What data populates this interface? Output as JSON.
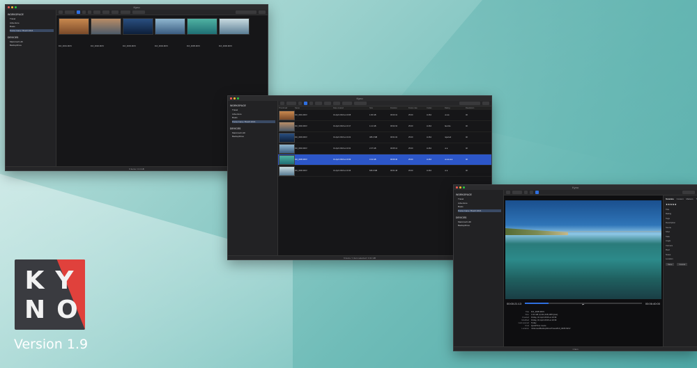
{
  "brand": {
    "logo_line1": "KY",
    "logo_line2": "NO",
    "version": "Version 1.9",
    "colors": {
      "logo_bg": "#3a3b40",
      "logo_accent": "#e0413c",
      "background": "#6fbcb8"
    }
  },
  "window_grid": {
    "title": "Kyno",
    "sidebar": {
      "section1": "WORKSPACE",
      "rows": [
        "Travel",
        "Adventure",
        "Boats",
        "Punta Cana / Brazil 2016"
      ],
      "section2": "DEVICES",
      "devices": [
        "Macintosh HD",
        "BackupDrive"
      ]
    },
    "thumbnails": [
      {
        "name": "DJI_0001.MOV",
        "colors": [
          "#7a4a2a",
          "#c8884e"
        ]
      },
      {
        "name": "DJI_0002.MOV",
        "colors": [
          "#4d5a68",
          "#b88c66"
        ]
      },
      {
        "name": "DJI_0003.MOV",
        "colors": [
          "#0d1f3a",
          "#2a4f80"
        ]
      },
      {
        "name": "DJI_0004.MOV",
        "colors": [
          "#3a5c80",
          "#8fb6cf"
        ]
      },
      {
        "name": "DJI_0005.MOV",
        "colors": [
          "#1f6f74",
          "#4fb2a2"
        ]
      },
      {
        "name": "DJI_0006.MOV",
        "colors": [
          "#5a7d94",
          "#c9dbe0"
        ]
      }
    ],
    "status": "6 items / 2.4 GB"
  },
  "window_list": {
    "title": "Kyno",
    "headers": [
      "Thumbnail",
      "Name",
      "Date created",
      "Size",
      "Duration",
      "Frame rate",
      "Codec",
      "Rating",
      "Resolution"
    ],
    "rows": [
      {
        "name": "DJI_0001.MOV",
        "date": "01 April 2016 at 10:08",
        "size": "1.66 GB",
        "duration": "00:03:41",
        "fps": "25.00",
        "codec": "H.264",
        "rating": "★★★",
        "res": "4K",
        "selected": false,
        "thumb": [
          "#7a4a2a",
          "#c8884e"
        ]
      },
      {
        "name": "DJI_0002.MOV",
        "date": "01 April 2016 at 10:17",
        "size": "1.12 GB",
        "duration": "00:02:34",
        "fps": "25.00",
        "codec": "H.264",
        "rating": "favorite",
        "res": "4K",
        "selected": false,
        "thumb": [
          "#4d5a68",
          "#b88c66"
        ]
      },
      {
        "name": "DJI_0003.MOV",
        "date": "01 April 2016 at 10:22",
        "size": "486.3 MB",
        "duration": "00:01:02",
        "fps": "25.00",
        "codec": "H.264",
        "rating": "rejected",
        "res": "4K",
        "selected": false,
        "thumb": [
          "#0d1f3a",
          "#2a4f80"
        ]
      },
      {
        "name": "DJI_0004.MOV",
        "date": "01 April 2016 at 10:31",
        "size": "2.37 GB",
        "duration": "00:05:12",
        "fps": "25.00",
        "codec": "H.264",
        "rating": "★★",
        "res": "4K",
        "selected": false,
        "thumb": [
          "#3a5c80",
          "#8fb6cf"
        ]
      },
      {
        "name": "DJI_0005.MOV",
        "date": "01 April 2016 at 10:39",
        "size": "3.41 GB",
        "duration": "00:06:40",
        "fps": "25.00",
        "codec": "H.264",
        "rating": "★★★★★",
        "res": "4K",
        "selected": true,
        "thumb": [
          "#1f6f74",
          "#4fb2a2"
        ]
      },
      {
        "name": "DJI_0006.MOV",
        "date": "01 April 2016 at 10:46",
        "size": "845.9 MB",
        "duration": "00:01:48",
        "fps": "25.00",
        "codec": "H.264",
        "rating": "★★",
        "res": "4K",
        "selected": false,
        "thumb": [
          "#5a7d94",
          "#c9dbe0"
        ]
      }
    ],
    "status": "6 items / 1 item selected / 3.41 GB"
  },
  "window_player": {
    "title": "Kyno",
    "timecode_in": "00:00:21:13",
    "timecode_out": "00:06:40:00",
    "meta": [
      {
        "k": "Title",
        "v": "DJI_0005.MOV"
      },
      {
        "k": "Size",
        "v": "3.41 GB (3,412,448,108 bytes)"
      },
      {
        "k": "Created",
        "v": "Friday, 01 April 2016 at 10:39"
      },
      {
        "k": "Modified",
        "v": "Friday, 01 April 2016 at 10:39"
      },
      {
        "k": "Last opened",
        "v": "Today"
      },
      {
        "k": "Kind",
        "v": "QuickTime movie"
      },
      {
        "k": "Location",
        "v": "/Volumes/BackupDrive/Travel/DJI_0005.MOV"
      }
    ],
    "inspector_tabs": [
      "Metadata",
      "Content",
      "Markers",
      "Tags"
    ],
    "inspector_fields": [
      "Title",
      "Rating",
      "Tags",
      "Description",
      "Scene",
      "Shot",
      "Take",
      "Angle",
      "Camera",
      "Reel",
      "Notes",
      "Location"
    ],
    "rating": "★★★★★",
    "save_label": "Save",
    "cancel_label": "Cancel",
    "status": "1 item"
  }
}
